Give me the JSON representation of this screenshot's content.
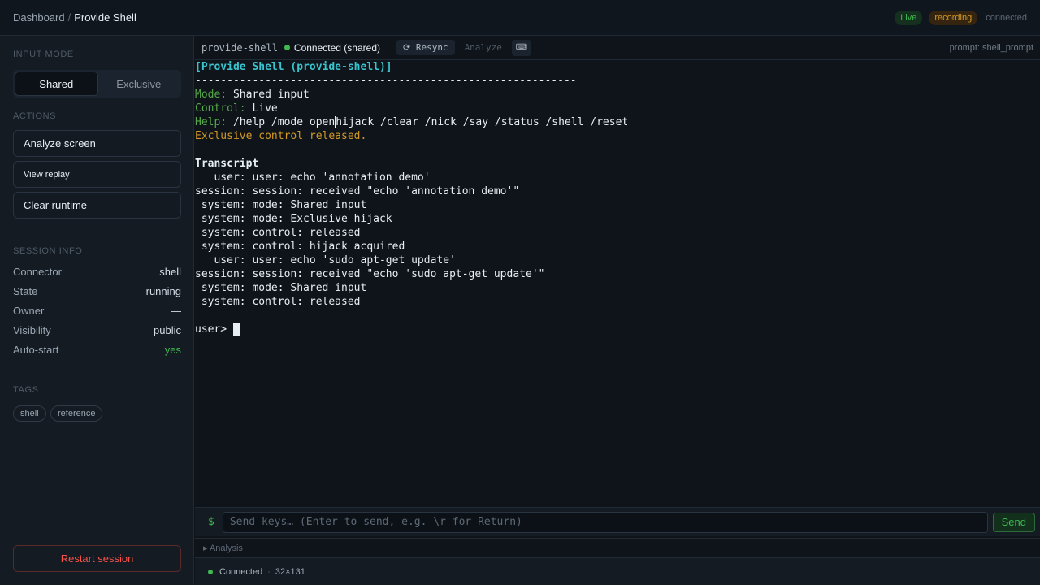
{
  "breadcrumb": {
    "root": "Dashboard",
    "sep": "/",
    "current": "Provide Shell"
  },
  "top_status": {
    "live": "Live",
    "recording": "recording",
    "connection": "connected"
  },
  "sidebar": {
    "input_mode_label": "INPUT MODE",
    "modes": [
      "Shared",
      "Exclusive"
    ],
    "active_mode": "Shared",
    "actions_label": "ACTIONS",
    "actions": [
      "Analyze screen",
      "View replay",
      "Clear runtime"
    ],
    "session_info_label": "SESSION INFO",
    "info": [
      {
        "key": "Connector",
        "value": "shell"
      },
      {
        "key": "State",
        "value": "running"
      },
      {
        "key": "Owner",
        "value": "—"
      },
      {
        "key": "Visibility",
        "value": "public"
      },
      {
        "key": "Auto-start",
        "value": "yes"
      }
    ],
    "tags_label": "TAGS",
    "tags": [
      "shell",
      "reference"
    ],
    "restart_label": "Restart session"
  },
  "toolbar": {
    "session_name": "provide-shell",
    "connection": "Connected (shared)",
    "resync": "⟳ Resync",
    "analyze": "Analyze",
    "kbd": "⌨",
    "prompt": "prompt: shell_prompt"
  },
  "terminal": {
    "banner": "[Provide Shell (provide-shell)]",
    "rule": "------------------------------------------------------------",
    "mode_key": "Mode:",
    "mode_val": " Shared input",
    "control_key": "Control:",
    "control_val": " Live",
    "help_key": "Help:",
    "help_val_a": " /help /mode open",
    "help_val_b": "hijack /clear /nick /say /status /shell /reset",
    "notice": "Exclusive control released.",
    "transcript_title": "Transcript",
    "transcript": [
      "   user: user: echo 'annotation demo'",
      "session: session: received \"echo 'annotation demo'\"",
      " system: mode: Shared input",
      " system: mode: Exclusive hijack",
      " system: control: released",
      " system: control: hijack acquired",
      "   user: user: echo 'sudo apt-get update'",
      "session: session: received \"echo 'sudo apt-get update'\"",
      " system: mode: Shared input",
      " system: control: released"
    ],
    "prompt": "user> "
  },
  "input": {
    "symbol": "$",
    "placeholder": "Send keys… (Enter to send, e.g. \\r for Return)",
    "value": "",
    "send_label": "Send"
  },
  "analysis": {
    "label": "▸ Analysis"
  },
  "statusbar": {
    "connection": "Connected",
    "sep": "·",
    "size": "32×131"
  },
  "colors": {
    "accent_green": "#3fb950",
    "amber": "#d29922",
    "danger": "#f85149",
    "cyan": "#39c5cf"
  }
}
